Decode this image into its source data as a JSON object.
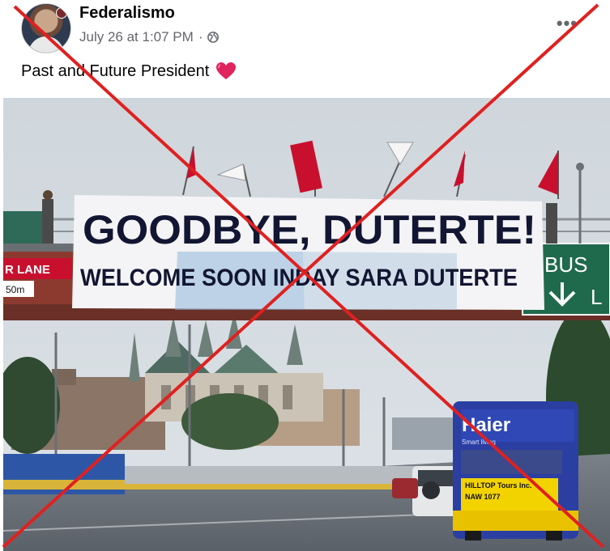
{
  "post": {
    "author": "Federalismo",
    "timestamp": "July 26 at 1:07 PM",
    "separator": "·",
    "caption": "Past and Future President",
    "more_icon": "more-options-icon",
    "privacy_icon": "globe-icon",
    "emoji": "red-heart-icon"
  },
  "photo": {
    "banner_line1": "GOODBYE, DUTERTE!",
    "banner_line2": "WELCOME SOON INDAY SARA DUTERTE",
    "sign_lane": "R LANE",
    "sign_dist": "50m",
    "sign_bus": "BUS",
    "sign_bus2": "L",
    "bus_brand": "Haier",
    "bus_brand_sub": "Smart living",
    "bus_ad": "HILLTOP Tours Inc.",
    "bus_ad2": "NAW 1077"
  },
  "overlay": {
    "type": "red-x-false-content-mark",
    "color": "#e02020"
  }
}
